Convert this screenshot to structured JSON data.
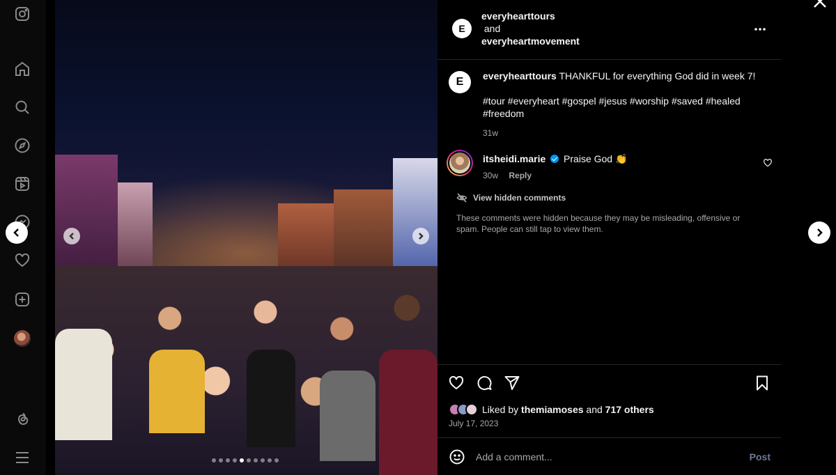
{
  "nav": {
    "icons": [
      "instagram-icon",
      "home-icon",
      "search-icon",
      "explore-icon",
      "reels-icon",
      "messages-icon",
      "notifications-icon",
      "create-icon",
      "profile-avatar",
      "threads-icon",
      "menu-icon"
    ]
  },
  "post_header": {
    "author1": "everyhearttours",
    "joiner": "and",
    "author2": "everyheartmovement",
    "logo_letter": "E"
  },
  "caption": {
    "user": "everyhearttours",
    "text": "THANKFUL for everything God did in week 7!",
    "tags": "#tour #everyheart #gospel #jesus #worship #saved #healed #freedom",
    "age": "31w"
  },
  "comments": [
    {
      "user": "itsheidi.marie",
      "text": "Praise God 👏",
      "age": "30w",
      "reply_label": "Reply"
    }
  ],
  "hidden": {
    "label": "View hidden comments",
    "note": "These comments were hidden because they may be misleading, offensive or spam. People can still tap to view them."
  },
  "actions": {
    "liked_prefix": "Liked by",
    "liked_user": "themiamoses",
    "liked_and": "and",
    "liked_others": "717 others",
    "date": "July 17, 2023"
  },
  "add_comment": {
    "placeholder": "Add a comment...",
    "post_label": "Post"
  },
  "carousel": {
    "count": 10,
    "active_index": 4
  },
  "colors": {
    "verified": "#0095f6",
    "post_disabled": "#6a7a96"
  }
}
